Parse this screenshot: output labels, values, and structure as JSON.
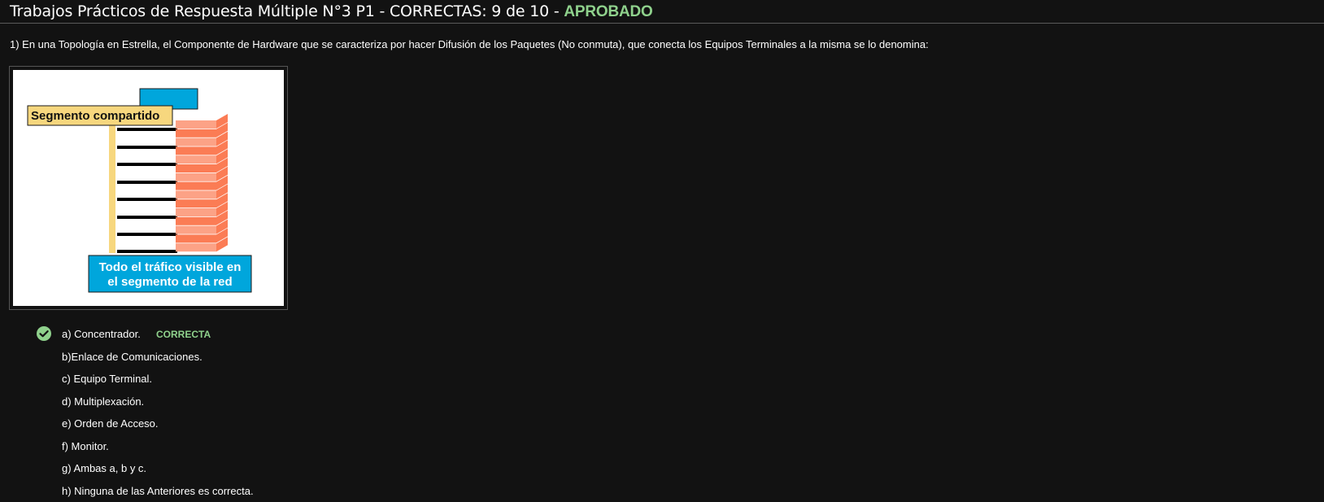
{
  "header": {
    "title": "Trabajos Prácticos de Respuesta Múltiple N°3 P1",
    "separator1": " - ",
    "score": "CORRECTAS: 9 de 10",
    "separator2": " - ",
    "status": "APROBADO",
    "status_color": "#8fd18c"
  },
  "question": {
    "text": "1) En una Topología en Estrella, el Componente de Hardware que se caracteriza por hacer Difusión de los Paquetes (No conmuta), que conecta los Equipos Terminales a la misma se lo denomina:"
  },
  "figure": {
    "label_top": "Segmento compartido",
    "label_bottom_line1": "Todo el tráfico visible en",
    "label_bottom_line2": "el segmento de la red",
    "colors": {
      "yellow": "#f7d77e",
      "blue": "#00a6dc",
      "brick": "#fb7c55",
      "brick_light": "#fca286"
    }
  },
  "answers": {
    "selected_icon": "check-circle-icon",
    "correct_label": "CORRECTA",
    "options": [
      "a) Concentrador.",
      "b)Enlace de Comunicaciones.",
      "c) Equipo Terminal.",
      "d) Multiplexación.",
      "e) Orden de Acceso.",
      "f) Monitor.",
      "g) Ambas a, b y c.",
      "h) Ninguna de las Anteriores es correcta."
    ]
  }
}
